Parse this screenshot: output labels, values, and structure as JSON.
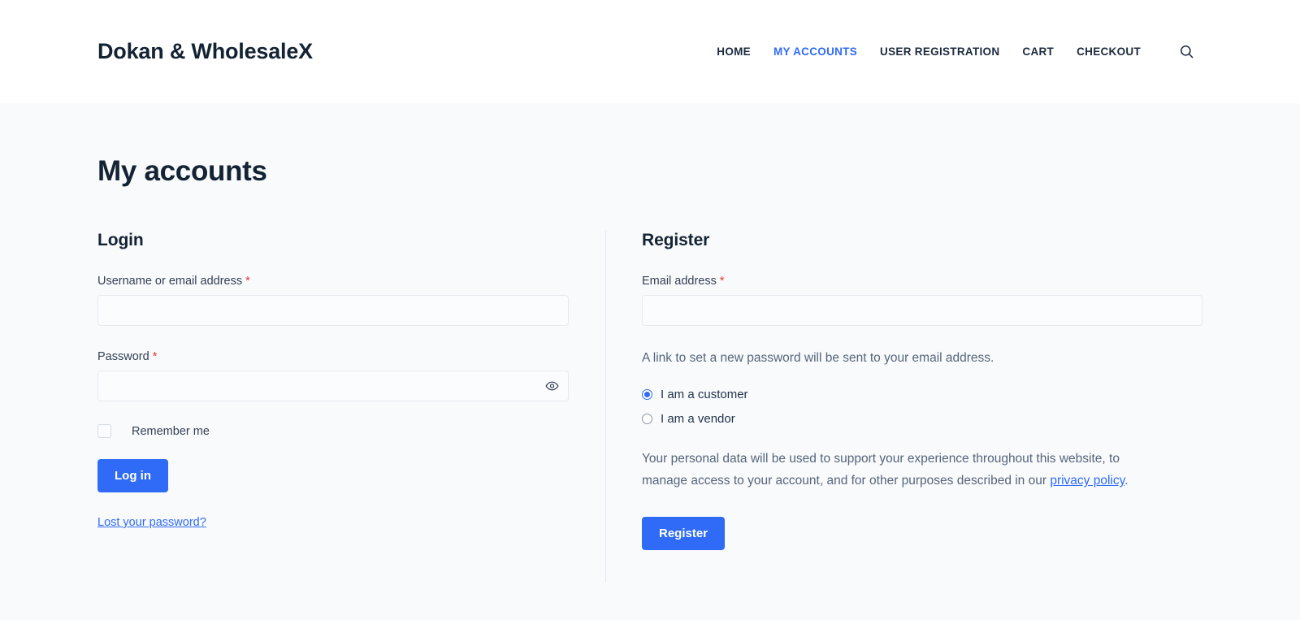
{
  "header": {
    "site_title": "Dokan & WholesaleX",
    "nav": [
      {
        "label": "HOME",
        "active": false
      },
      {
        "label": "MY ACCOUNTS",
        "active": true
      },
      {
        "label": "USER REGISTRATION",
        "active": false
      },
      {
        "label": "CART",
        "active": false
      },
      {
        "label": "CHECKOUT",
        "active": false
      }
    ],
    "search_icon": "search-icon"
  },
  "page": {
    "title": "My accounts"
  },
  "login": {
    "heading": "Login",
    "username_label": "Username or email address",
    "username_required": "*",
    "username_value": "",
    "username_placeholder": "",
    "password_label": "Password",
    "password_required": "*",
    "password_value": "",
    "password_placeholder": "",
    "password_toggle_icon": "eye-icon",
    "remember_label": "Remember me",
    "remember_checked": false,
    "submit_label": "Log in",
    "lost_password_label": "Lost your password?"
  },
  "register": {
    "heading": "Register",
    "email_label": "Email address",
    "email_required": "*",
    "email_value": "",
    "email_placeholder": "",
    "helper_text": "A link to set a new password will be sent to your email address.",
    "roles": [
      {
        "label": "I am a customer",
        "selected": true
      },
      {
        "label": "I am a vendor",
        "selected": false
      }
    ],
    "privacy_text_before": "Your personal data will be used to support your experience throughout this website, to manage access to your account, and for other purposes described in our ",
    "privacy_link_label": "privacy policy",
    "privacy_text_after": ".",
    "submit_label": "Register"
  },
  "colors": {
    "accent": "#2f6bf6",
    "heading": "#142334",
    "required": "#e63535",
    "page_bg": "#f8fafc",
    "header_bg": "#ffffff"
  }
}
